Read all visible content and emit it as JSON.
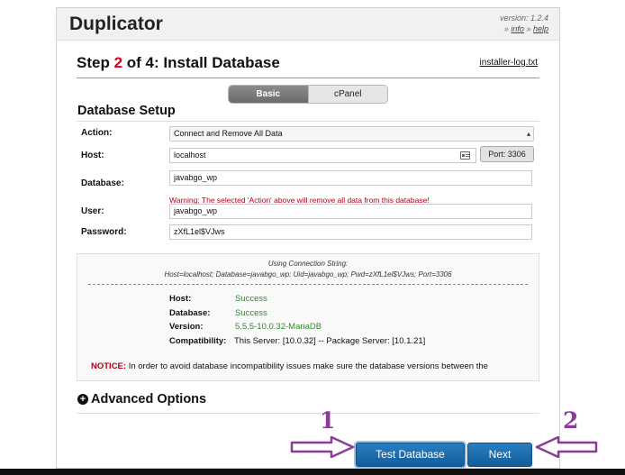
{
  "header": {
    "app_title": "Duplicator",
    "version": "version: 1.2.4",
    "version_links_prefix": "»",
    "info_link": "info",
    "links_separator": "»",
    "help_link": "help"
  },
  "step": {
    "prefix": "Step",
    "number": "2",
    "suffix": "of 4: Install Database",
    "log_link": "installer-log.txt"
  },
  "tabs": [
    {
      "label": "Basic",
      "active": true
    },
    {
      "label": "cPanel",
      "active": false
    }
  ],
  "section_title": "Database Setup",
  "form": {
    "action_label": "Action:",
    "action_value": "Connect and Remove All Data",
    "host_label": "Host:",
    "host_value": "localhost",
    "port_button": "Port: 3306",
    "database_label": "Database:",
    "database_value": "javabgo_wp",
    "warning_prefix": "Warning: The selected 'Action' above will remove",
    "warning_link": "all data",
    "warning_suffix": "from this database!",
    "user_label": "User:",
    "user_value": "javabgo_wp",
    "password_label": "Password:",
    "password_value": "zXfL1el$VJws"
  },
  "results": {
    "conn_title": "Using Connection String:",
    "conn_string": "Host=localhost; Database=javabgo_wp; Uid=javabgo_wp; Pwd=zXfL1el$VJws; Port=3306",
    "host_label": "Host:",
    "host_value": "Success",
    "database_label": "Database:",
    "database_value": "Success",
    "version_label": "Version:",
    "version_value": "5.5.5-10.0.32-MariaDB",
    "compat_label": "Compatibility:",
    "compat_value": "This Server: [10.0.32] -- Package Server: [10.1.21]",
    "notice_label": "NOTICE:",
    "notice_text": "In order to avoid database incompatibility issues make sure the database versions between the"
  },
  "advanced_options": "Advanced Options",
  "buttons": {
    "test_database": "Test Database",
    "next": "Next"
  },
  "markers": {
    "one": "1",
    "two": "2"
  },
  "colors": {
    "accent_red": "#d0021b",
    "button_blue": "#1f6fad",
    "success_green": "#2e8b2e",
    "annotation_purple": "#8a3c96"
  }
}
